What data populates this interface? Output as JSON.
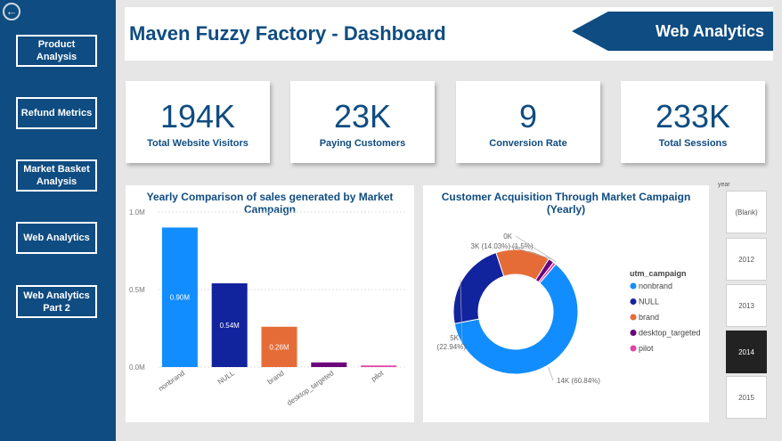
{
  "sidebar": {
    "back_icon": "arrow-left-circle-icon",
    "items": [
      {
        "label": "Product Analysis"
      },
      {
        "label": "Refund Metrics"
      },
      {
        "label": "Market Basket Analysis"
      },
      {
        "label": "Web Analytics"
      },
      {
        "label": "Web Analytics Part 2"
      }
    ]
  },
  "header": {
    "title": "Maven Fuzzy Factory - Dashboard",
    "page_banner": "Web Analytics"
  },
  "cards": [
    {
      "value": "194K",
      "label": "Total Website Visitors"
    },
    {
      "value": "23K",
      "label": "Paying Customers"
    },
    {
      "value": "9",
      "label": "Conversion Rate"
    },
    {
      "value": "233K",
      "label": "Total Sessions"
    }
  ],
  "bar_panel": {
    "title": "Yearly Comparison of sales generated by Market Campaign"
  },
  "donut_panel": {
    "title": "Customer Acquisition Through Market Campaign (Yearly)"
  },
  "slicer": {
    "title": "year",
    "options": [
      "(Blank)",
      "2012",
      "2013",
      "2014",
      "2015"
    ],
    "selected": "2014"
  },
  "colors": {
    "navy": "#0f4c81",
    "nonbrand": "#118dff",
    "null": "#12239e",
    "brand": "#e66c37",
    "desktop_targeted": "#6b007b",
    "pilot": "#e044a7"
  },
  "chart_data": [
    {
      "type": "bar",
      "title": "Yearly Comparison of sales generated by Market Campaign",
      "categories": [
        "nonbrand",
        "NULL",
        "brand",
        "desktop_targeted",
        "pilot"
      ],
      "values": [
        0.9,
        0.54,
        0.26,
        0.03,
        0.01
      ],
      "data_labels": [
        "0.90M",
        "0.54M",
        "0.26M",
        "",
        ""
      ],
      "y_ticks": [
        "0.0M",
        "0.5M",
        "1.0M"
      ],
      "ylim": [
        0,
        1.0
      ],
      "colors": [
        "#118dff",
        "#12239e",
        "#e66c37",
        "#6b007b",
        "#e044a7"
      ]
    },
    {
      "type": "pie",
      "title": "Customer Acquisition Through Market Campaign (Yearly)",
      "legend_title": "utm_campaign",
      "legend_position": "right",
      "categories": [
        "nonbrand",
        "NULL",
        "brand",
        "desktop_targeted",
        "pilot"
      ],
      "values": [
        60.84,
        22.94,
        14.03,
        1.5,
        0.69
      ],
      "slice_labels": [
        "14K (60.84%)",
        "5K (22.94%)",
        "3K (14.03%)",
        "(1.5%)",
        "0K"
      ],
      "colors": [
        "#118dff",
        "#12239e",
        "#e66c37",
        "#6b007b",
        "#e044a7"
      ]
    }
  ]
}
